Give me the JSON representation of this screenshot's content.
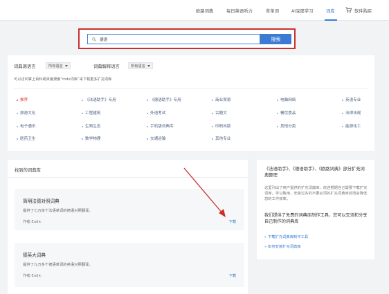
{
  "nav": {
    "items": [
      {
        "label": "欧路词典"
      },
      {
        "label": "每日英语听力"
      },
      {
        "label": "背单词"
      },
      {
        "label": "AI深度学习"
      },
      {
        "label": "词库"
      },
      {
        "label": "软件购买"
      }
    ],
    "active_index": 4
  },
  "search": {
    "query": "德语",
    "button_label": "搜索"
  },
  "filters": {
    "source_lang_label": "词典源语言",
    "source_lang_value": "所有语言",
    "explain_lang_label": "词典解释语言",
    "explain_lang_value": "所有语言",
    "hint": "可以访问掌上百科或百度搜索“mdx词库”来下载更多扩充词库",
    "categories": [
      {
        "label": "推荐",
        "active": true
      },
      {
        "label": "《法语助手》专用"
      },
      {
        "label": "《德语助手》专用"
      },
      {
        "label": "商业贸易"
      },
      {
        "label": "电脑网络"
      },
      {
        "label": "英语专业"
      },
      {
        "label": "旅游文化"
      },
      {
        "label": "工程建筑"
      },
      {
        "label": "外语考试"
      },
      {
        "label": "古籍文"
      },
      {
        "label": "餐饮食品"
      },
      {
        "label": "法律法规"
      },
      {
        "label": "电子通讯"
      },
      {
        "label": "生物生态"
      },
      {
        "label": "手机版词典库"
      },
      {
        "label": "印刷出版"
      },
      {
        "label": "其他分类"
      },
      {
        "label": "能源化工"
      },
      {
        "label": "医药卫生"
      },
      {
        "label": "数学物理"
      },
      {
        "label": "交通运输"
      },
      {
        "label": "其他专业"
      }
    ]
  },
  "found": {
    "title": "找到的词典库",
    "dicts": [
      {
        "name": "简明法德对照词典",
        "desc": "提供了七万余个法语单词的德语对照翻译。",
        "author": "作者:Eudic",
        "download": "下载"
      },
      {
        "name": "德英大词典",
        "desc": "提供了九万多个德语单词的英语对照翻译。",
        "author": "作者:Eudic",
        "download": "下载"
      }
    ]
  },
  "sidebar": {
    "heading": "《法语助手》、《德语助手》、《欧路词典》部分扩充词典整理",
    "text": "这里列出了用户提供的扩充词典库，欢迎根据自己需要下载扩充词库，学以致用，安装过多的不要必须的扩充词典库反而会降低您的工作效率。",
    "strong": "我们提供了免费的词典库制作工具，您可以交流和分享自己制作的词典库",
    "links": [
      {
        "label": "» 下载扩充词典库制作工具"
      },
      {
        "label": "» 如何安装扩充词典库"
      }
    ]
  },
  "colors": {
    "accent": "#3b7bd3",
    "highlight_border": "#c9302c",
    "active_category": "#e53935"
  }
}
